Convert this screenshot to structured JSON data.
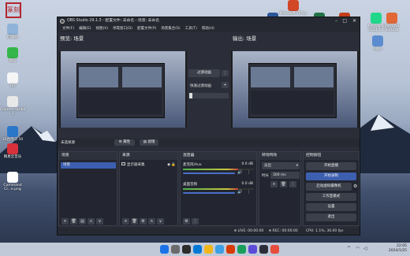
{
  "desktop": {
    "seal_text": "篆刻",
    "icons": [
      {
        "label": "回收站",
        "color": "#8fb3d9"
      },
      {
        "label": "微信",
        "color": "#35b64a"
      },
      {
        "label": "QQ",
        "color": "#f5f5f5"
      },
      {
        "label": "Counter-Strike 2",
        "color": "#e8e8e8"
      },
      {
        "label": "33台内-2.50",
        "color": "#2a77c9"
      },
      {
        "label": "网易云音乐",
        "color": "#d9313c"
      },
      {
        "label": "Command Ci...e.png",
        "color": "#ffffff"
      }
    ],
    "top_right": [
      {
        "label": "Microsoft Office",
        "color": "#d24726"
      },
      {
        "label": "",
        "color": "#2b579a"
      },
      {
        "label": "",
        "color": "#217346"
      },
      {
        "label": "",
        "color": "#c43e1c"
      },
      {
        "label": "PyCharm 2023.2.1",
        "color": "#21d789"
      },
      {
        "label": "MATLAB R2023a",
        "color": "#e16737"
      },
      {
        "label": "Apps",
        "color": "#5b8ccf"
      }
    ]
  },
  "window": {
    "title": "OBS Studio 29.1.3 - 配置文件: 未命名 - 场景: 未命名",
    "menu": [
      "文件(F)",
      "编辑(E)",
      "视图(V)",
      "停靠窗口(D)",
      "配置文件(P)",
      "场景集合(S)",
      "工具(T)",
      "帮助(H)"
    ],
    "preview_label": "预览: 场景",
    "program_label": "输出: 场景",
    "transition_btn": "过渡动画",
    "quick_transition": "快速过渡动画",
    "no_source": "未选择源",
    "props_btn": "属性",
    "filters_btn": "滤镜"
  },
  "scenes": {
    "header": "场景",
    "items": [
      "场景"
    ]
  },
  "sources": {
    "header": "来源",
    "items": [
      "显示器采集"
    ]
  },
  "mixer": {
    "header": "混音器",
    "tracks": [
      {
        "name": "麦克风/Aux",
        "db": "0.0 dB",
        "level": 0.78
      },
      {
        "name": "桌面音频",
        "db": "0.0 dB",
        "level": 0.78
      }
    ]
  },
  "transitions": {
    "header": "转场特效",
    "type": "淡出",
    "duration_label": "时长",
    "duration": "300 ms"
  },
  "controls": {
    "header": "控制按钮",
    "buttons": [
      "开始直播",
      "开始录制",
      "启动虚拟摄像机",
      "工作室模式",
      "设置",
      "退出"
    ]
  },
  "status": {
    "live": "LIVE: 00:00:00",
    "rec": "REC: 00:00:00",
    "cpu": "CPU: 1.1%, 30.00 fps"
  },
  "taskbar": {
    "time": "22:05",
    "date": "2024/1/25"
  },
  "colors": {
    "accent": "#3d5fb0",
    "scene_selected": "#3d5fb0",
    "panel": "#232630"
  }
}
